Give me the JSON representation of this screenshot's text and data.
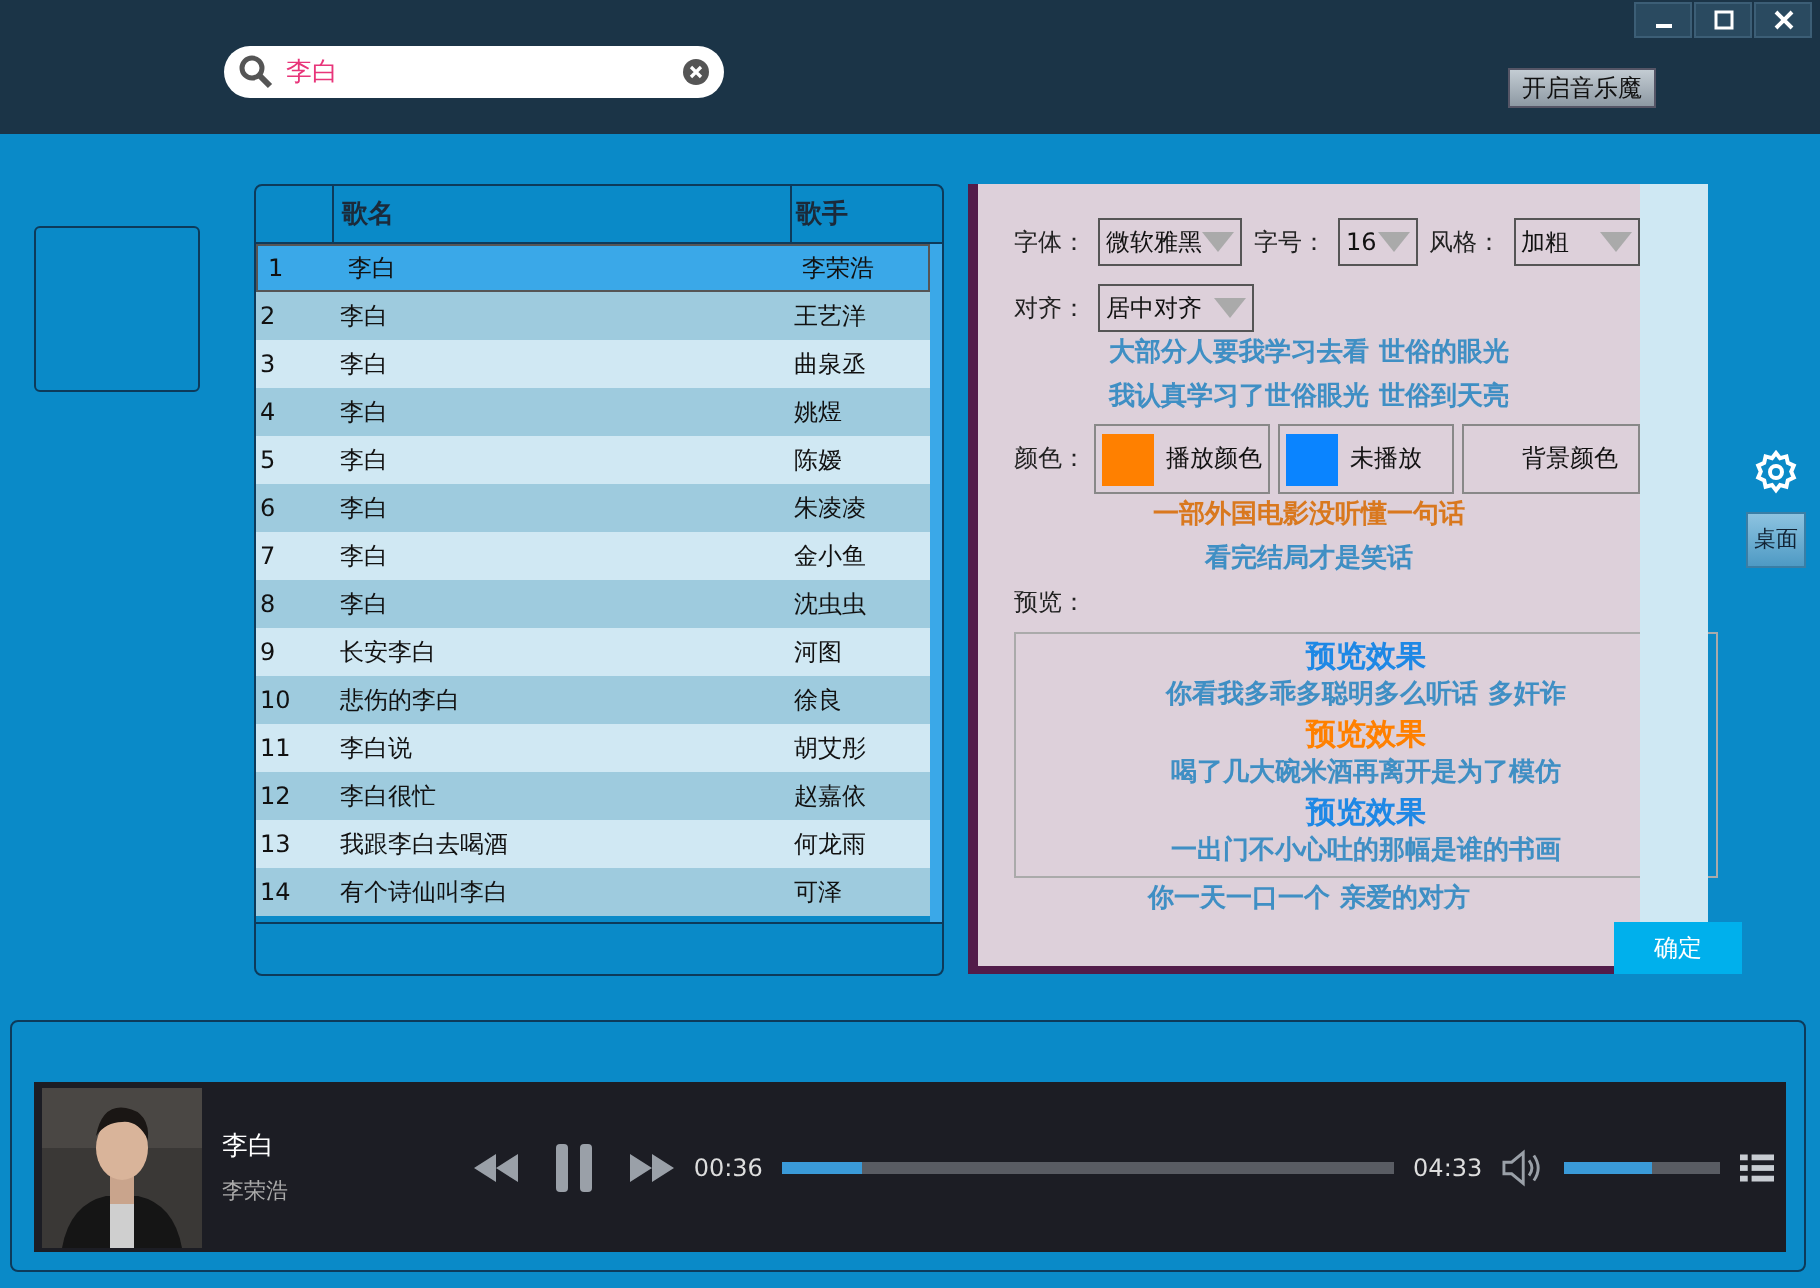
{
  "search": {
    "value": "李白"
  },
  "top_button": "开启音乐魔",
  "table": {
    "columns": [
      "歌名",
      "歌手"
    ],
    "rows": [
      {
        "index": "1",
        "title": "李白",
        "singer": "李荣浩",
        "selected": true
      },
      {
        "index": "2",
        "title": "李白",
        "singer": "王艺洋",
        "selected": false
      },
      {
        "index": "3",
        "title": "李白",
        "singer": "曲泉丞",
        "selected": false
      },
      {
        "index": "4",
        "title": "李白",
        "singer": "姚煜",
        "selected": false
      },
      {
        "index": "5",
        "title": "李白",
        "singer": "陈嫒",
        "selected": false
      },
      {
        "index": "6",
        "title": "李白",
        "singer": "朱凌凌",
        "selected": false
      },
      {
        "index": "7",
        "title": "李白",
        "singer": "金小鱼",
        "selected": false
      },
      {
        "index": "8",
        "title": "李白",
        "singer": "沈虫虫",
        "selected": false
      },
      {
        "index": "9",
        "title": "长安李白",
        "singer": "河图",
        "selected": false
      },
      {
        "index": "10",
        "title": "悲伤的李白",
        "singer": "徐良",
        "selected": false
      },
      {
        "index": "11",
        "title": "李白说",
        "singer": "胡艾彤",
        "selected": false
      },
      {
        "index": "12",
        "title": "李白很忙",
        "singer": "赵嘉依",
        "selected": false
      },
      {
        "index": "13",
        "title": "我跟李白去喝酒",
        "singer": "何龙雨",
        "selected": false
      },
      {
        "index": "14",
        "title": "有个诗仙叫李白",
        "singer": "可泽",
        "selected": false
      }
    ]
  },
  "settings": {
    "font_label": "字体：",
    "font": "微软雅黑",
    "size_label": "字号：",
    "size": "16",
    "style_label": "风格：",
    "style": "加粗",
    "align_label": "对齐：",
    "align": "居中对齐",
    "color_label": "颜色：",
    "colors": [
      {
        "label": "播放颜色",
        "color": "#ff8000"
      },
      {
        "label": "未播放",
        "color": "#0a84ff"
      },
      {
        "label": "背景颜色"
      }
    ],
    "preview_label": "预览：",
    "preview": [
      {
        "text": "预览效果",
        "color": "#1e88e5"
      },
      {
        "text": "预览效果",
        "color": "#ff8000"
      },
      {
        "text": "预览效果",
        "color": "#1e88e5"
      }
    ],
    "ok": "确定"
  },
  "lyrics": [
    {
      "text": "大部分人要我学习去看 世俗的眼光",
      "selected": false
    },
    {
      "text": "我认真学习了世俗眼光 世俗到天亮",
      "selected": false
    },
    {
      "text": "一部外国电影没听懂一句话",
      "selected": true
    },
    {
      "text": "看完结局才是笑话",
      "selected": false
    },
    {
      "text": "你看我多乖多聪明多么听话 多奸诈",
      "selected": false
    },
    {
      "text": "喝了几大碗米酒再离开是为了模仿",
      "selected": false
    },
    {
      "text": "一出门不小心吐的那幅是谁的书画",
      "selected": false
    },
    {
      "text": "你一天一口一个 亲爱的对方",
      "selected": false
    }
  ],
  "desktop_button": "桌面",
  "player": {
    "title": "李白",
    "artist": "李荣浩",
    "elapsed": "00:36",
    "duration": "04:33",
    "progress": {
      "level": 0.13
    },
    "volume": {
      "level": 0.56
    }
  }
}
